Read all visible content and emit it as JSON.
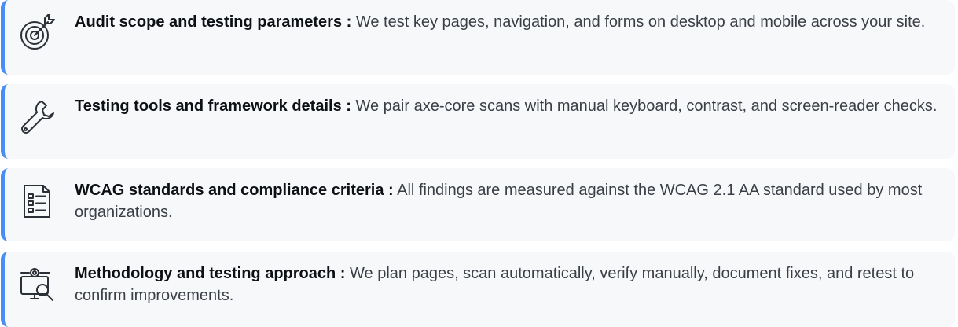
{
  "items": [
    {
      "icon": "target-icon",
      "title": "Audit scope and testing parameters :",
      "description": " We test key pages, navigation, and forms on desktop and mobile across your site."
    },
    {
      "icon": "wrench-icon",
      "title": "Testing tools and framework details :",
      "description": " We pair axe-core scans with manual keyboard, contrast, and screen-reader checks."
    },
    {
      "icon": "checklist-document-icon",
      "title": "WCAG standards and compliance criteria :",
      "description": " All findings are measured against the WCAG 2.1 AA standard used by most organizations."
    },
    {
      "icon": "monitor-search-gear-icon",
      "title": "Methodology and testing approach :",
      "description": " We plan pages, scan automatically, verify manually, document fixes, and retest to confirm improvements."
    }
  ],
  "colors": {
    "accent": "#4a8ef2",
    "card_background": "#f7f8fa",
    "title_text": "#0d1014",
    "body_text": "#3a3f46"
  }
}
